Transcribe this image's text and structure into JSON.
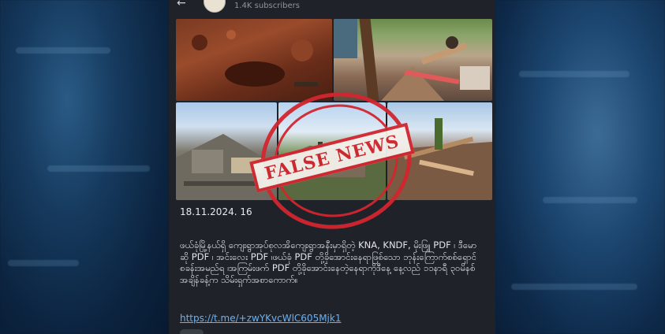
{
  "channel": {
    "subscribers": "1.4K subscribers"
  },
  "post": {
    "date": "18.11.2024. 16",
    "body": "ဖယ်ခုံမြို့နယ်ရှိ ကျေးရွာအုပ်စုလအိကျေးရွာအနီးမှာရှိတဲ့ KNA, KNDF, မိုးဖြူ PDF ၊ ဒီမောဆို PDF ၊ အင်းလေး PDF ၊ဖယ်ခုံ PDF တို့ခိုအောင်းနေရာဖြစ်သော ဘုန်းကြောက်စစ်ရှောင်စခန်းအမည်ရ ၊အကြမ်းဖက် PDF တို့ခိုအောင်းနေတဲ့နေရာကိုဒီနေ့ နေ့လည် ၁၁နာရီ ၃၀မိနစ်အချိန်ခန့်က သိမ်းရှက်အစာကောက်။",
    "link": "https://t.me/+zwYKvcWlC605Mjk1"
  },
  "stamp": {
    "label": "FALSE NEWS",
    "color": "#d2262f"
  },
  "icons": [
    "back-arrow-icon",
    "channel-avatar",
    "reaction-icon"
  ]
}
